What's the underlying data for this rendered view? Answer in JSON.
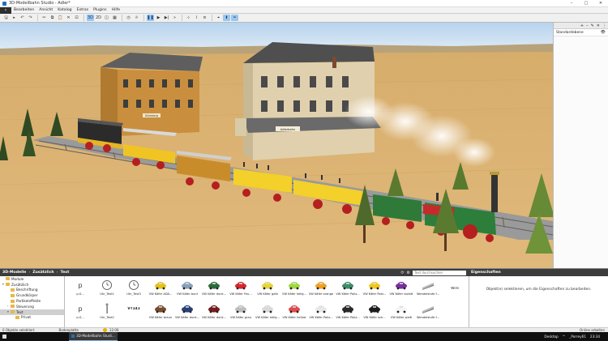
{
  "window": {
    "title": "3D-Modellbahn Studio - Adler*",
    "controls": [
      "–",
      "□",
      "✕"
    ]
  },
  "menu": {
    "back": "‹",
    "items": [
      "Bearbeiten",
      "Ansicht",
      "Katalog",
      "Extras",
      "Plugins",
      "Hilfe"
    ]
  },
  "toolbar": {
    "groups": [
      [
        {
          "icon": "save-icon",
          "glyph": "🖫"
        },
        {
          "icon": "new-icon",
          "glyph": "▸"
        },
        {
          "icon": "undo-icon",
          "glyph": "↶"
        },
        {
          "icon": "redo-icon",
          "glyph": "↷"
        }
      ],
      [
        {
          "icon": "cut-icon",
          "glyph": "✂"
        },
        {
          "icon": "copy-icon",
          "glyph": "⧉"
        },
        {
          "icon": "paste-icon",
          "glyph": "📋"
        },
        {
          "icon": "delete-icon",
          "glyph": "✕"
        },
        {
          "icon": "duplicate-icon",
          "glyph": "⊡"
        }
      ],
      [
        {
          "icon": "3d-icon",
          "glyph": "3D",
          "active": true
        },
        {
          "icon": "2d-icon",
          "glyph": "2D"
        },
        {
          "icon": "camera-icon",
          "glyph": "◫"
        },
        {
          "icon": "grid-icon",
          "glyph": "▦"
        }
      ],
      [
        {
          "icon": "clock-icon",
          "glyph": "◷"
        },
        {
          "icon": "weather-icon",
          "glyph": "☼"
        }
      ],
      [
        {
          "icon": "pause-icon",
          "glyph": "❚❚",
          "active": true
        },
        {
          "icon": "play-icon",
          "glyph": "▶"
        },
        {
          "icon": "step-icon",
          "glyph": "▶|"
        },
        {
          "icon": "fast-icon",
          "glyph": "»"
        }
      ],
      [
        {
          "icon": "snap-icon",
          "glyph": "⊹"
        },
        {
          "icon": "measure-icon",
          "glyph": "⌇"
        },
        {
          "icon": "layer-icon",
          "glyph": "≡"
        }
      ],
      [
        {
          "icon": "target-icon",
          "glyph": "⌖"
        },
        {
          "icon": "arrow-icon",
          "glyph": "⬆",
          "active": true
        },
        {
          "icon": "rail-icon",
          "glyph": "═",
          "active": true
        }
      ]
    ]
  },
  "layers": {
    "tools": [
      "+",
      "–",
      "✎",
      "✕",
      "⋮"
    ],
    "items": [
      {
        "label": "Standardebene"
      }
    ]
  },
  "catalog": {
    "breadcrumb": [
      "3D-Modelle",
      "Zusätzlich",
      "Text"
    ],
    "tools": [
      "⟳",
      "⚙"
    ],
    "search_placeholder": "Text durchsuchen",
    "tree": [
      {
        "label": "Module",
        "level": 0,
        "arrow": ""
      },
      {
        "label": "Zusätzlich",
        "level": 0,
        "arrow": "▾"
      },
      {
        "label": "Beschriftung",
        "level": 1,
        "arrow": ""
      },
      {
        "label": "Grundkörper",
        "level": 1,
        "arrow": ""
      },
      {
        "label": "Partikeleffekte",
        "level": 1,
        "arrow": ""
      },
      {
        "label": "Steuerung",
        "level": 1,
        "arrow": "›"
      },
      {
        "label": "Text",
        "level": 1,
        "arrow": "▾",
        "selected": true
      },
      {
        "label": "Privat",
        "level": 2,
        "arrow": ""
      }
    ],
    "row1": [
      {
        "label": "p-S...",
        "thumb": "p",
        "color": "#333333"
      },
      {
        "label": "Uhr_Test1",
        "thumb": "clock",
        "color": "#f4f4f4"
      },
      {
        "label": "Uhr_Test3",
        "thumb": "clock",
        "color": "#f4f4f4"
      },
      {
        "label": "VW Käfer ADA...",
        "thumb": "car",
        "color": "#e6c21a"
      },
      {
        "label": "VW Käfer bunt",
        "thumb": "car",
        "color": "#8aa0b8"
      },
      {
        "label": "VW Käfer dunk...",
        "thumb": "car",
        "color": "#2e6b3a"
      },
      {
        "label": "VW Käfer Feu...",
        "thumb": "car",
        "color": "#d8262b"
      },
      {
        "label": "VW Käfer gelb",
        "thumb": "car",
        "color": "#e9d33a"
      },
      {
        "label": "VW Käfer hellg...",
        "thumb": "car",
        "color": "#9fdb3c"
      },
      {
        "label": "VW Käfer orange",
        "thumb": "car",
        "color": "#f0a020"
      },
      {
        "label": "VW Käfer Poliz...",
        "thumb": "car",
        "color": "#3e8c6a"
      },
      {
        "label": "VW Käfer Post...",
        "thumb": "car",
        "color": "#f2c81e"
      },
      {
        "label": "VW Käfer violett",
        "thumb": "car",
        "color": "#7a2f9c"
      },
      {
        "label": "Wendelstufe f...",
        "thumb": "ramp",
        "color": "#999999"
      },
      {
        "label": "Wire",
        "thumb": "none",
        "color": "#ffffff"
      }
    ],
    "row2": [
      {
        "label": "p-S...",
        "thumb": "p",
        "color": "#333333"
      },
      {
        "label": "Uhr_Test2",
        "thumb": "pole",
        "color": "#555555"
      },
      {
        "label": "VT141",
        "thumb": "text",
        "color": "#222222",
        "bold": true
      },
      {
        "label": "VW Käfer braun",
        "thumb": "car",
        "color": "#7a4a2a"
      },
      {
        "label": "VW Käfer dunk...",
        "thumb": "car",
        "color": "#2b3f7a"
      },
      {
        "label": "VW Käfer dunk...",
        "thumb": "car",
        "color": "#7a1a1a"
      },
      {
        "label": "VW Käfer grau",
        "thumb": "car",
        "color": "#bdbdbd"
      },
      {
        "label": "VW Käfer hellg...",
        "thumb": "car",
        "color": "#d9d9d9"
      },
      {
        "label": "VW Käfer hellrot",
        "thumb": "car",
        "color": "#e24a4a"
      },
      {
        "label": "VW Käfer Poliz...",
        "thumb": "car",
        "color": "#e8e8e8"
      },
      {
        "label": "VW Käfer Poliz...",
        "thumb": "car",
        "color": "#2b2b2b"
      },
      {
        "label": "VW Käfer sch...",
        "thumb": "car",
        "color": "#1c1c1c"
      },
      {
        "label": "VW Käfer weiß",
        "thumb": "car",
        "color": "#f5f5f5"
      },
      {
        "label": "Wendelstufe f...",
        "thumb": "ramp",
        "color": "#999999"
      }
    ]
  },
  "properties": {
    "title": "Eigenschaften",
    "message": "Objekt(e) selektieren, um die Eigenschaften zu bearbeiten."
  },
  "status": {
    "selection": "0 Objekte selektiert",
    "ground": "Bodenplatte",
    "time": "12:00",
    "online": "Online arbeiten"
  },
  "taskbar": {
    "task_label": "3D-Modellbahn Studi...",
    "tray": [
      "Desktop",
      "^",
      "_Porrey61"
    ],
    "clock": "23:34"
  },
  "scene": {
    "station_sign": "Adlerbahn",
    "station_sign_2": "Nürnberg",
    "colors": {
      "sky": "#c9ddf0",
      "sand": "#d9b071",
      "rail": "#8d8d8d"
    }
  }
}
